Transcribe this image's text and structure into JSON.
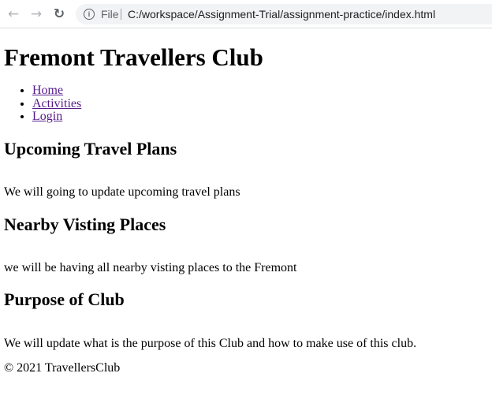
{
  "browser": {
    "back_icon": "arrow-left-icon",
    "forward_icon": "arrow-right-icon",
    "reload_icon": "reload-icon",
    "scheme_label": "File",
    "url": "C:/workspace/Assignment-Trial/assignment-practice/index.html"
  },
  "page": {
    "title": "Fremont Travellers Club",
    "nav": [
      {
        "label": "Home"
      },
      {
        "label": "Activities"
      },
      {
        "label": "Login"
      }
    ],
    "sections": [
      {
        "heading": "Upcoming Travel Plans",
        "text": "We will going to update upcoming travel plans"
      },
      {
        "heading": "Nearby Visting Places",
        "text": "we will be having all nearby visting places to the Fremont"
      },
      {
        "heading": "Purpose of Club",
        "text": "We will update what is the purpose of this Club and how to make use of this club."
      }
    ],
    "footer": "© 2021 TravellersClub"
  }
}
